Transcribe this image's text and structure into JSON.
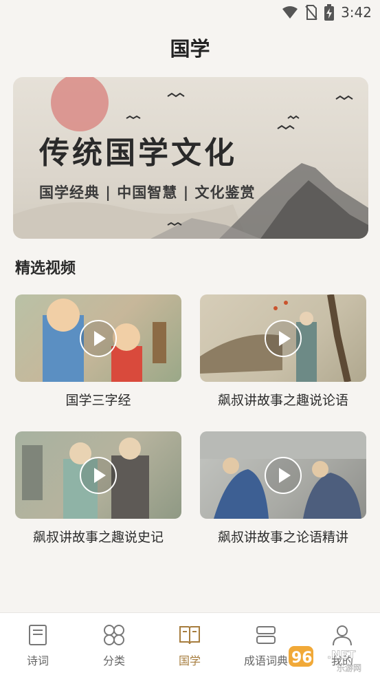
{
  "status_bar": {
    "time": "3:42"
  },
  "page": {
    "title": "国学"
  },
  "banner": {
    "title": "传统国学文化",
    "subtitle": "国学经典 | 中国智慧 | 文化鉴赏"
  },
  "section": {
    "title": "精选视频"
  },
  "videos": [
    {
      "title": "国学三字经"
    },
    {
      "title": "飙叔讲故事之趣说论语"
    },
    {
      "title": "飙叔讲故事之趣说史记"
    },
    {
      "title": "飙叔讲故事之论语精讲"
    }
  ],
  "tabs": [
    {
      "label": "诗词",
      "icon": "book-icon"
    },
    {
      "label": "分类",
      "icon": "grid-icon"
    },
    {
      "label": "国学",
      "icon": "open-book-icon",
      "active": true
    },
    {
      "label": "成语词典",
      "icon": "dictionary-icon"
    },
    {
      "label": "我的",
      "icon": "user-icon"
    }
  ],
  "watermark": {
    "text": "962.NET",
    "subtext": "乐游网"
  },
  "colors": {
    "accent": "#a67c3d",
    "background": "#f6f4f1"
  }
}
